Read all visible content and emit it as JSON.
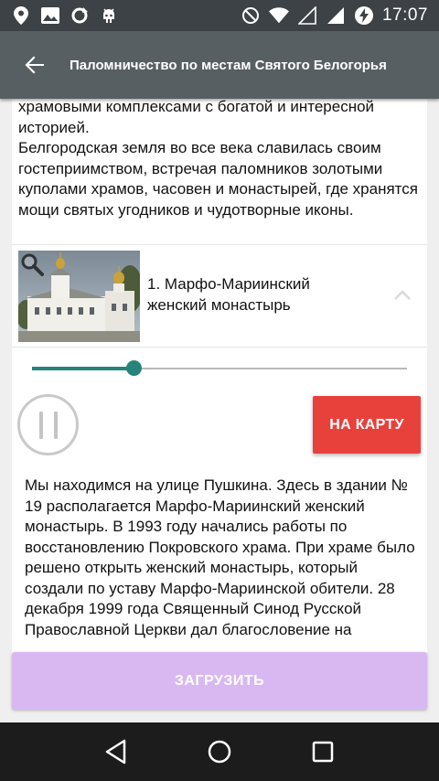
{
  "status_bar": {
    "time": "17:07",
    "left_icons": [
      "location-pin-icon",
      "image-icon",
      "sync-icon",
      "android-debug-icon"
    ],
    "right_icons": [
      "do-not-disturb-icon",
      "wifi-icon",
      "signal-icon",
      "signal-icon",
      "battery-charging-icon"
    ]
  },
  "toolbar": {
    "title": "Паломничество по местам Святого Белогорья",
    "back_icon": "arrow-back-icon"
  },
  "intro": {
    "text": "храмовыми комплексами с богатой и интересной историей.\nБелгородская земля во все века славилась своим гостеприимством, встречая паломников золотыми куполами храмов, часовен и монастырей, где хранятся мощи святых угодников и чудотворные иконы."
  },
  "item": {
    "title": "1. Марфо-Мариинский женский монастырь",
    "thumbnail_icon": "zoom-icon",
    "expanded": true
  },
  "player": {
    "progress": 0.27,
    "pause_icon": "pause-icon"
  },
  "map_button": {
    "label": "НА КАРТУ"
  },
  "description": {
    "text": "Мы находимся на улице Пушкина. Здесь в здании № 19 располагается Марфо-Мариинский женский монастырь. В 1993 году начались работы по восстановлению Покровского храма. При храме было решено открыть женский монастырь, который создали по уставу Марфо-Мариинской обители. 28 декабря 1999 года Священный Синод Русской Православной Церкви дал благословение на"
  },
  "download_button": {
    "label": "ЗАГРУЗИТЬ"
  },
  "colors": {
    "status_bar": "#3c4245",
    "toolbar": "#585f63",
    "accent_teal": "#26847a",
    "map_button": "#e8413c",
    "download_button": "#d9b8f2"
  },
  "nav_bar": {
    "icons": [
      "back-triangle-icon",
      "home-circle-icon",
      "recents-square-icon"
    ]
  }
}
